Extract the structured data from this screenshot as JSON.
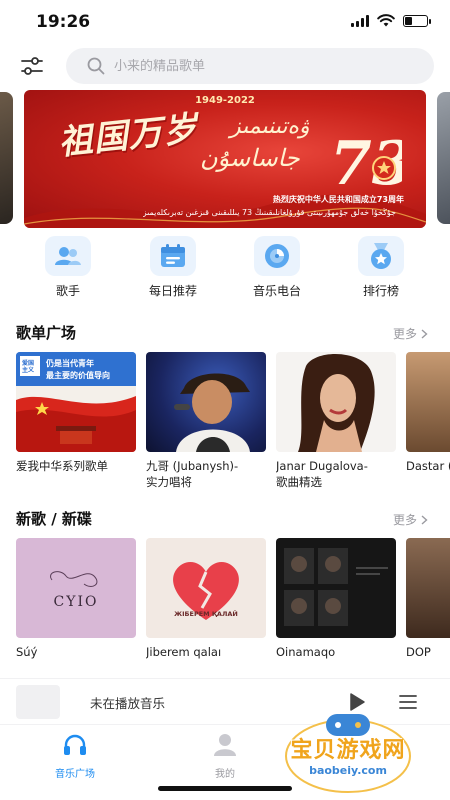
{
  "status_bar": {
    "time": "19:26",
    "battery_level": 0.35
  },
  "search": {
    "placeholder": "小来的精品歌单"
  },
  "banner": {
    "years": "1949-2022",
    "headline": "祖国万岁",
    "uyghur_line1": "ۋەتىنىمىز",
    "uyghur_line2": "جاساسۇن",
    "number": "73",
    "subtitle_cn": "热烈庆祝中华人民共和国成立73周年",
    "subtitle_ug": "جۇڭخۇا خەلق جۇمھۇرىيىتى قۇرۇلغانلىقىنىڭ 73 يىللىقىنى قىزغىن تەبرىكلەيمىز"
  },
  "quick_nav": [
    {
      "label": "歌手",
      "icon": "singer-icon"
    },
    {
      "label": "每日推荐",
      "icon": "calendar-icon"
    },
    {
      "label": "音乐电台",
      "icon": "radio-icon"
    },
    {
      "label": "排行榜",
      "icon": "medal-icon"
    }
  ],
  "playlists": {
    "title": "歌单广场",
    "more": "更多",
    "items": [
      {
        "title": "爱我中华系列歌单",
        "cover_text_1": "爱国主义",
        "cover_text_2": "仍是当代青年",
        "cover_text_3": "最主要的价值导向"
      },
      {
        "title": "九哥 (Jubanysh)-\n实力唱将"
      },
      {
        "title": "Janar Dugalova-\n歌曲精选"
      },
      {
        "title": "Dastar\n(精选"
      }
    ]
  },
  "new_songs": {
    "title": "新歌 / 新碟",
    "more": "更多",
    "items": [
      {
        "title": "Súý",
        "cover_text": "CYIO"
      },
      {
        "title": "Jiberem qalaı",
        "cover_text": "ЖІБЕРЕМ ҚАЛАЙ"
      },
      {
        "title": "Oinamaqo"
      },
      {
        "title": "DOP"
      }
    ]
  },
  "player": {
    "text": "未在播放音乐"
  },
  "tabs": [
    {
      "label": "音乐广场",
      "active": true
    },
    {
      "label": "我的",
      "active": false
    }
  ],
  "watermark": {
    "text": "宝贝游戏网",
    "url": "baobeiy.com"
  },
  "colors": {
    "accent": "#1e8cf0",
    "banner_red": "#c8221b",
    "icon_bg": "#eaf3fd",
    "watermark_orange": "#f0a41c"
  }
}
